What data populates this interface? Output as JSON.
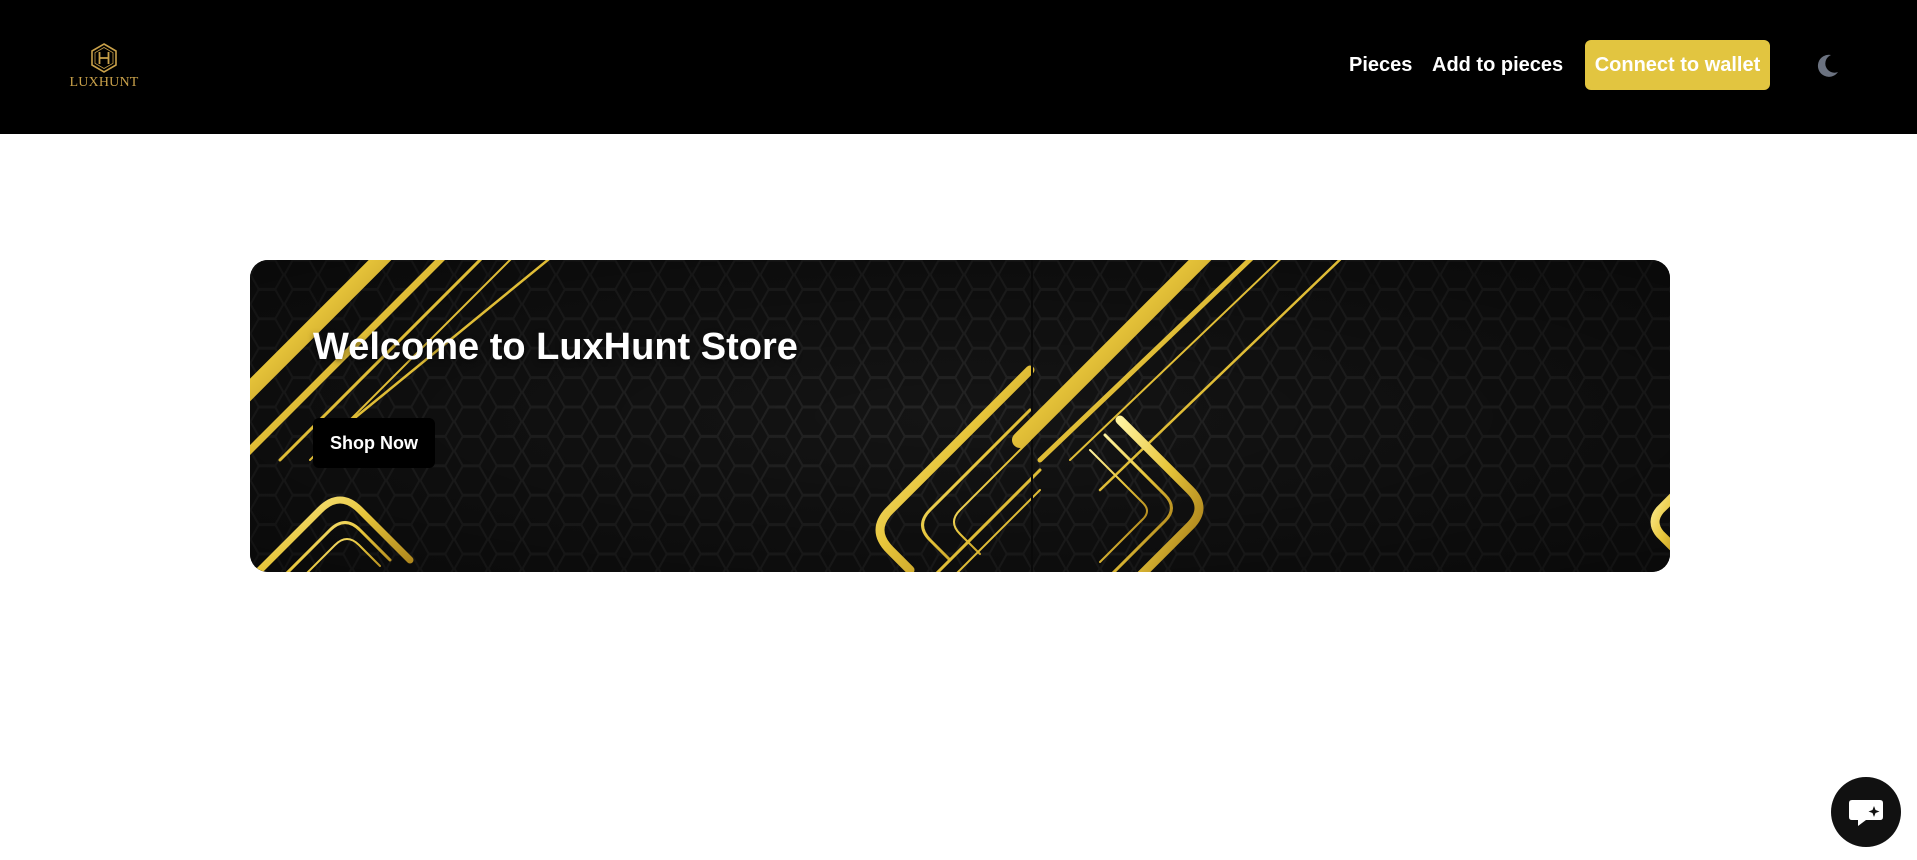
{
  "header": {
    "logo": {
      "icon": "hexagon-h-monogram-icon",
      "text": "LUXHUNT"
    },
    "nav": [
      {
        "label": "Pieces"
      },
      {
        "label": "Add to pieces"
      }
    ],
    "wallet_button_label": "Connect to wallet",
    "theme_toggle_icon": "moon-icon",
    "background_color": "#000000",
    "accent_color": "#e2c540",
    "logo_color": "#c9a14a"
  },
  "hero": {
    "title": "Welcome to LuxHunt Store",
    "shop_button_label": "Shop Now",
    "background_theme": "black hexagon pattern with gold diagonal stripes"
  },
  "chat": {
    "icon": "chat-bubble-sparkle-icon"
  }
}
